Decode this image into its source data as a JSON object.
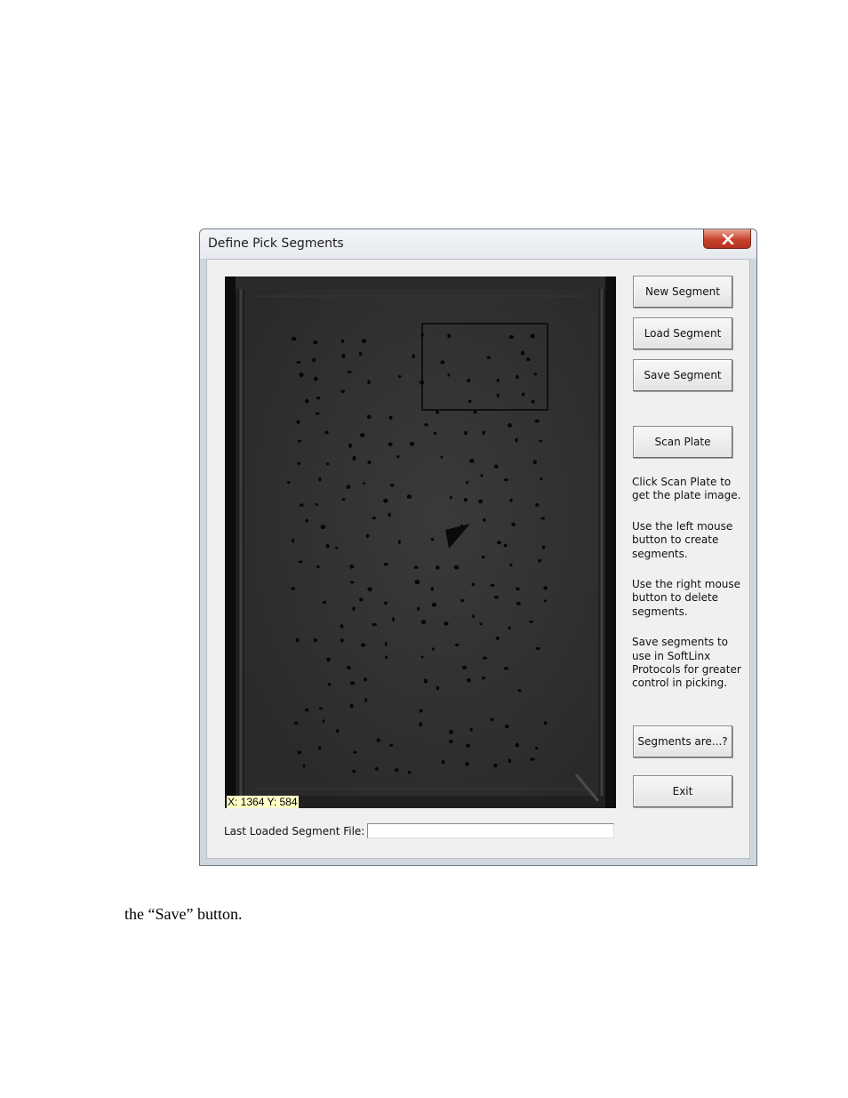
{
  "window": {
    "title": "Define Pick Segments",
    "close_icon": "close-icon"
  },
  "plate": {
    "coordinate_readout": "X: 1364 Y: 584"
  },
  "buttons": {
    "new_segment": "New Segment",
    "load_segment": "Load Segment",
    "save_segment": "Save Segment",
    "scan_plate": "Scan Plate",
    "segments_are": "Segments are...?",
    "exit": "Exit"
  },
  "instructions": [
    "Click Scan Plate to get the plate image.",
    "Use the left mouse button to create segments.",
    "Use the right mouse button to delete segments.",
    "Save segments to use in SoftLinx Protocols for greater control in picking."
  ],
  "file": {
    "label": "Last Loaded Segment File:",
    "value": ""
  },
  "caption": "the “Save” button."
}
